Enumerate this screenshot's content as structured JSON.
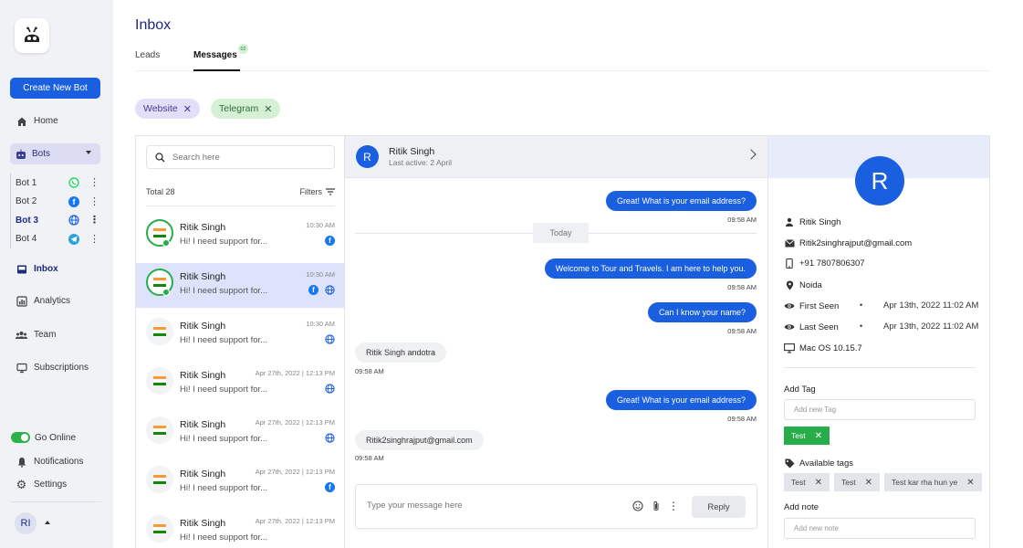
{
  "colors": {
    "accent": "#1a5fe0",
    "online": "#27ad4a",
    "bots_pill": "#dcdcf3",
    "selected_row": "#dde3fb"
  },
  "sidebar": {
    "create_button": "Create New Bot",
    "nav": [
      {
        "label": "Home",
        "icon": "home-icon"
      },
      {
        "label": "Bots",
        "icon": "bot-icon"
      },
      {
        "label": "Inbox",
        "icon": "inbox-icon"
      },
      {
        "label": "Analytics",
        "icon": "analytics-icon"
      },
      {
        "label": "Team",
        "icon": "team-icon"
      },
      {
        "label": "Subscriptions",
        "icon": "subscriptions-icon"
      }
    ],
    "bots": [
      {
        "label": "Bot 1",
        "channel": "whatsapp-icon"
      },
      {
        "label": "Bot 2",
        "channel": "facebook-icon"
      },
      {
        "label": "Bot 3",
        "channel": "globe-icon"
      },
      {
        "label": "Bot 4",
        "channel": "telegram-icon"
      }
    ],
    "go_online": "Go Online",
    "notifications": "Notifications",
    "settings": "Settings",
    "user_initials": "RI"
  },
  "header": {
    "title": "Inbox",
    "tabs": [
      {
        "label": "Leads"
      },
      {
        "label": "Messages",
        "badge": "02"
      }
    ]
  },
  "filters": [
    {
      "label": "Website"
    },
    {
      "label": "Telegram"
    }
  ],
  "list": {
    "search_placeholder": "Search here",
    "total": "Total 28",
    "filters_label": "Filters",
    "items": [
      {
        "name": "Ritik Singh",
        "message": "Hi! I need support for...",
        "time": "10:30 AM"
      },
      {
        "name": "Ritik Singh",
        "message": "Hi! I need support for...",
        "time": "10:30 AM"
      },
      {
        "name": "Ritik Singh",
        "message": "Hi! I need support for...",
        "time": "10:30 AM"
      },
      {
        "name": "Ritik Singh",
        "message": "Hi! I need support for...",
        "time": "Apr 27th, 2022 | 12:13 PM"
      },
      {
        "name": "Ritik Singh",
        "message": "Hi! I need support for...",
        "time": "Apr 27th, 2022 | 12:13 PM"
      },
      {
        "name": "Ritik Singh",
        "message": "Hi! I need support for...",
        "time": "Apr 27th, 2022 | 12:13 PM"
      },
      {
        "name": "Ritik Singh",
        "message": "Hi! I need support for...",
        "time": "Apr 27th, 2022 | 12:13 PM"
      }
    ]
  },
  "chat": {
    "avatar": "R",
    "name": "Ritik Singh",
    "last_active": "Last active: 2 April",
    "today": "Today",
    "messages": [
      {
        "text": "Great! What is your email address?",
        "time": "09:58 AM"
      },
      {
        "text": "Welcome to Tour and Travels. I am here to help you.",
        "time": "09:58 AM"
      },
      {
        "text": "Can I know your name?",
        "time": "09:58 AM"
      },
      {
        "text": "Ritik Singh andotra",
        "time": "09:58 AM"
      },
      {
        "text": "Great! What is your email address?",
        "time": "09:58 AM"
      },
      {
        "text": "Ritik2singhrajput@gmail.com",
        "time": "09:58 AM"
      }
    ],
    "composer_placeholder": "Type your message here",
    "reply_label": "Reply"
  },
  "info": {
    "avatar": "R",
    "name": "Ritik Singh",
    "email": "Ritik2singhrajput@gmail.com",
    "phone": "+91 7807806307",
    "location": "Noida",
    "first_seen_label": "First Seen",
    "first_seen": "Apr 13th, 2022 11:02 AM",
    "last_seen_label": "Last Seen",
    "last_seen": "Apr 13th, 2022 11:02 AM",
    "os": "Mac OS 10.15.7",
    "add_tag_label": "Add Tag",
    "add_tag_placeholder": "Add new Tag",
    "current_tag": "Test",
    "available_tags_label": "Available tags",
    "available_tags": [
      "Test",
      "Test",
      "Test kar rha hun ye"
    ],
    "add_note_label": "Add note",
    "add_note_placeholder": "Add new note"
  }
}
